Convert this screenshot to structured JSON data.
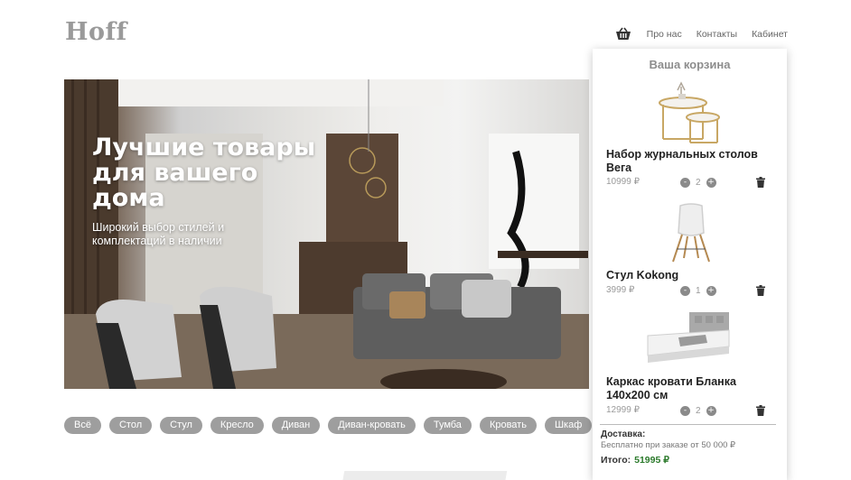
{
  "header": {
    "logo": "Hoff",
    "nav": {
      "cart_icon": "basket-icon",
      "about": "Про нас",
      "contacts": "Контакты",
      "account": "Кабинет"
    }
  },
  "hero": {
    "title": "Лучшие товары для вашего дома",
    "subtitle": "Широкий выбор стилей и комплектаций в наличии"
  },
  "categories": [
    "Всё",
    "Стол",
    "Стул",
    "Кресло",
    "Диван",
    "Диван-кровать",
    "Тумба",
    "Кровать",
    "Шкаф"
  ],
  "cart": {
    "title": "Ваша корзина",
    "items": [
      {
        "name": "Набор журнальных столов Вега",
        "price": "10999 ₽",
        "qty": "2"
      },
      {
        "name": "Стул Kokong",
        "price": "3999 ₽",
        "qty": "1"
      },
      {
        "name": "Каркас кровати Бланка 140x200 см",
        "price": "12999 ₽",
        "qty": "2"
      }
    ],
    "qty_minus": "-",
    "qty_plus": "+",
    "delivery_label": "Доставка:",
    "delivery_note": "Бесплатно при заказе от 50 000 ₽",
    "total_label": "Итого:",
    "total_value": "51995 ₽"
  },
  "colors": {
    "accent_total": "#2b7a2b",
    "category_pill": "#9e9e9e",
    "logo": "#9a9a9a"
  }
}
